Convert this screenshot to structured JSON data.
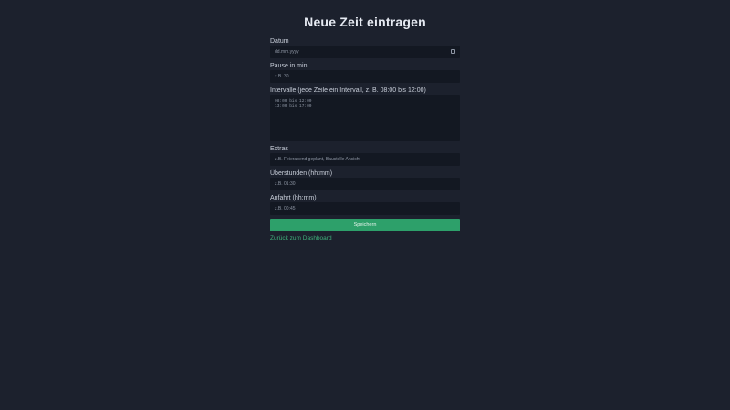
{
  "page": {
    "title": "Neue Zeit eintragen"
  },
  "form": {
    "datum": {
      "label": "Datum",
      "placeholder": "dd.mm.yyyy"
    },
    "pause": {
      "label": "Pause in min",
      "placeholder": "z.B. 30"
    },
    "intervals": {
      "label": "Intervalle (jede Zeile ein Intervall, z. B. 08:00 bis 12:00)",
      "lines": [
        "08:00 bis 12:00",
        "13:00 bis 17:00"
      ]
    },
    "extras": {
      "label": "Extras",
      "placeholder": "z.B. Feierabend geplant, Baustelle Ansicht"
    },
    "ueberstunden": {
      "label": "Überstunden (hh:mm)",
      "placeholder": "z.B. 01:30"
    },
    "anfahrt": {
      "label": "Anfahrt (hh:mm)",
      "placeholder": "z.B. 00:45"
    },
    "submit_label": "Speichern",
    "back_link": "Zurück zum Dashboard"
  },
  "colors": {
    "background": "#1c212d",
    "field": "#131822",
    "accent": "#2da06a",
    "link": "#3fb07a"
  },
  "icons": {
    "date_picker": "calendar-icon"
  }
}
